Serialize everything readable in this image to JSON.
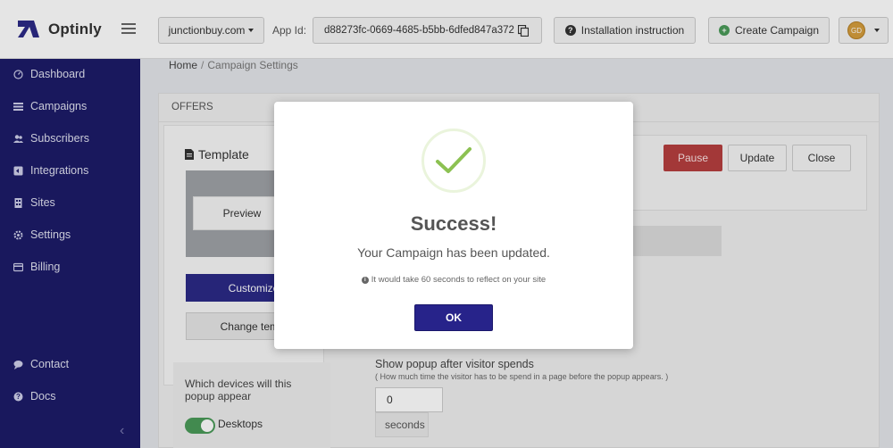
{
  "header": {
    "logo_text": "Optinly",
    "site_select": "junctionbuy.com",
    "app_id_label": "App Id:",
    "app_id_value": "d88273fc-0669-4685-b5bb-6dfed847a372",
    "install_label": "Installation instruction",
    "create_label": "Create Campaign",
    "avatar_initials": "GD"
  },
  "sidebar": {
    "items": [
      {
        "label": "Dashboard",
        "icon": "dashboard-icon"
      },
      {
        "label": "Campaigns",
        "icon": "list-icon"
      },
      {
        "label": "Subscribers",
        "icon": "users-icon"
      },
      {
        "label": "Integrations",
        "icon": "plug-icon"
      },
      {
        "label": "Sites",
        "icon": "sites-icon"
      },
      {
        "label": "Settings",
        "icon": "gear-icon"
      },
      {
        "label": "Billing",
        "icon": "credit-card-icon"
      }
    ],
    "bottom": [
      {
        "label": "Contact",
        "icon": "chat-icon"
      },
      {
        "label": "Docs",
        "icon": "help-icon"
      }
    ]
  },
  "breadcrumb": {
    "home": "Home",
    "separator": "/",
    "current": "Campaign Settings"
  },
  "panel": {
    "header": "OFFERS",
    "template_title": "Template",
    "preview_label": "Preview",
    "customize_label": "Customize",
    "change_template_label": "Change templ",
    "devices_label": "Which devices will this popup appear",
    "desktop_label": "Desktops",
    "pause_label": "Pause",
    "update_label": "Update",
    "close_label": "Close",
    "spend_label": "Show popup after visitor spends",
    "spend_hint": "( How much time the visitor has to be spend in a page before the popup appears. )",
    "spend_value": "0",
    "seconds_label": "seconds"
  },
  "modal": {
    "title": "Success!",
    "message": "Your Campaign has been updated.",
    "note": "It would take 60 seconds to reflect on your site",
    "ok_label": "OK"
  },
  "colors": {
    "sidebar": "#1c1b68",
    "primary": "#27238a",
    "danger": "#b63f3f",
    "success_check": "#8cc152"
  }
}
